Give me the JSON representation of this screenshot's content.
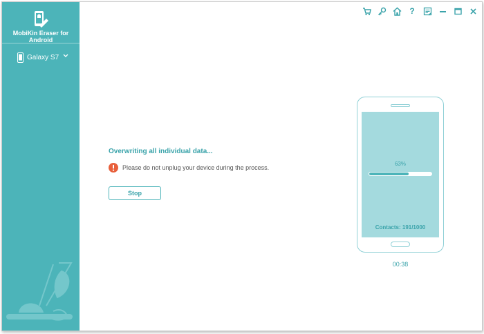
{
  "app": {
    "title": "MobiKin Eraser for Android",
    "accent_color": "#4cb4b9",
    "logo_icon": "android-eraser-logo-icon"
  },
  "sidebar": {
    "device": {
      "name": "Galaxy S7",
      "icon": "phone-icon",
      "dropdown_icon": "chevron-down-icon"
    }
  },
  "titlebar": {
    "buttons": [
      {
        "name": "cart",
        "icon": "cart-icon"
      },
      {
        "name": "key",
        "icon": "key-icon"
      },
      {
        "name": "home",
        "icon": "home-icon"
      },
      {
        "name": "help",
        "label": "?",
        "icon": "help-icon"
      },
      {
        "name": "feedback",
        "icon": "feedback-icon"
      },
      {
        "name": "minimize",
        "icon": "minimize-icon"
      },
      {
        "name": "maximize",
        "icon": "maximize-icon"
      },
      {
        "name": "close",
        "icon": "close-icon"
      }
    ]
  },
  "main": {
    "status_title": "Overwriting all individual data...",
    "warning_text": "Please do not unplug your device during the process.",
    "warning_color": "#e8603c",
    "stop_label": "Stop"
  },
  "progress": {
    "percent_label": "63%",
    "percent": 63,
    "contacts_label": "Contacts: 191/1000",
    "elapsed": "00:38"
  }
}
